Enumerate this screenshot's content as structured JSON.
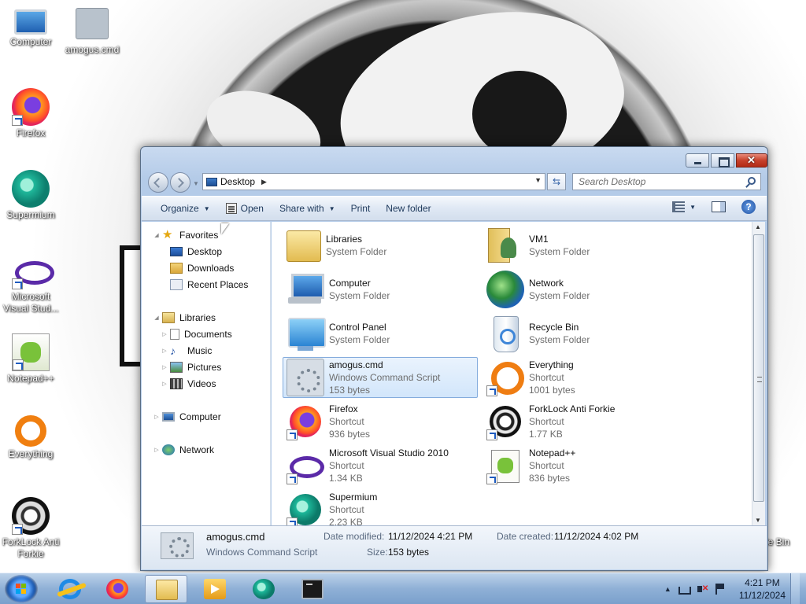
{
  "desktop": {
    "icons": [
      {
        "label": "Computer",
        "icon": "computer-icon"
      },
      {
        "label": "amogus.cmd",
        "icon": "script-icon"
      },
      {
        "label": "Firefox",
        "icon": "firefox-icon"
      },
      {
        "label": "Supermium",
        "icon": "supermium-icon"
      },
      {
        "label": "Microsoft Visual Stud...",
        "icon": "visual-studio-icon"
      },
      {
        "label": "Notepad++",
        "icon": "notepadpp-icon"
      },
      {
        "label": "Everything",
        "icon": "everything-icon"
      },
      {
        "label": "ForkLock Anti Forkie",
        "icon": "forklock-icon"
      },
      {
        "label": "le Bin",
        "icon": "recycle-bin-icon"
      }
    ]
  },
  "window": {
    "address": {
      "crumb": "Desktop"
    },
    "search": {
      "placeholder": "Search Desktop"
    },
    "toolbar": {
      "organize": "Organize",
      "open": "Open",
      "share_with": "Share with",
      "print": "Print",
      "new_folder": "New folder"
    },
    "nav": {
      "favorites": "Favorites",
      "desktop": "Desktop",
      "downloads": "Downloads",
      "recent_places": "Recent Places",
      "libraries": "Libraries",
      "documents": "Documents",
      "music": "Music",
      "pictures": "Pictures",
      "videos": "Videos",
      "computer": "Computer",
      "network": "Network"
    },
    "items": [
      {
        "name": "Libraries",
        "line2": "System Folder",
        "line3": "",
        "icon": "libraries-icon"
      },
      {
        "name": "VM1",
        "line2": "System Folder",
        "line3": "",
        "icon": "user-folder-icon"
      },
      {
        "name": "Computer",
        "line2": "System Folder",
        "line3": "",
        "icon": "computer-icon"
      },
      {
        "name": "Network",
        "line2": "System Folder",
        "line3": "",
        "icon": "network-icon"
      },
      {
        "name": "Control Panel",
        "line2": "System Folder",
        "line3": "",
        "icon": "control-panel-icon"
      },
      {
        "name": "Recycle Bin",
        "line2": "System Folder",
        "line3": "",
        "icon": "recycle-bin-icon"
      },
      {
        "name": "amogus.cmd",
        "line2": "Windows Command Script",
        "line3": "153 bytes",
        "icon": "script-icon",
        "selected": true
      },
      {
        "name": "Everything",
        "line2": "Shortcut",
        "line3": "1001 bytes",
        "icon": "everything-icon"
      },
      {
        "name": "Firefox",
        "line2": "Shortcut",
        "line3": "936 bytes",
        "icon": "firefox-icon"
      },
      {
        "name": "ForkLock Anti Forkie",
        "line2": "Shortcut",
        "line3": "1.77 KB",
        "icon": "forklock-icon"
      },
      {
        "name": "Microsoft Visual Studio 2010",
        "line2": "Shortcut",
        "line3": "1.34 KB",
        "icon": "visual-studio-icon"
      },
      {
        "name": "Notepad++",
        "line2": "Shortcut",
        "line3": "836 bytes",
        "icon": "notepadpp-icon"
      },
      {
        "name": "Supermium",
        "line2": "Shortcut",
        "line3": "2.23 KB",
        "icon": "supermium-icon"
      }
    ],
    "details": {
      "name": "amogus.cmd",
      "type": "Windows Command Script",
      "date_modified_label": "Date modified:",
      "date_modified": "11/12/2024 4:21 PM",
      "date_created_label": "Date created:",
      "date_created": "11/12/2024 4:02 PM",
      "size_label": "Size:",
      "size": "153 bytes"
    }
  },
  "taskbar": {
    "clock_time": "4:21 PM",
    "clock_date": "11/12/2024"
  }
}
